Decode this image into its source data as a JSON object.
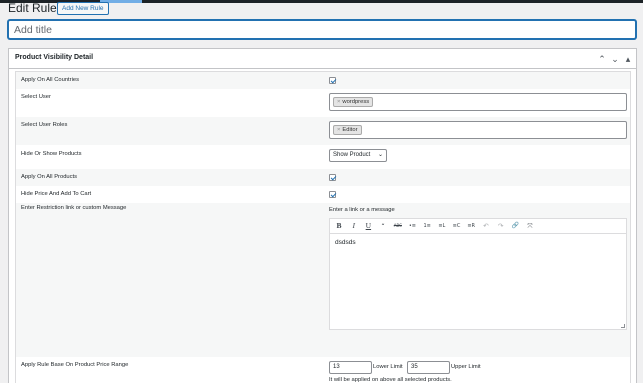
{
  "header": {
    "page_title": "Edit Rule",
    "add_new_label": "Add New Rule"
  },
  "title_input": {
    "placeholder": "Add title",
    "value": ""
  },
  "postbox": {
    "title": "Product Visibility Detail",
    "controls": {
      "move_up": "chevron-up",
      "move_down": "chevron-down",
      "toggle": "triangle-up"
    }
  },
  "fields": {
    "apply_all_countries": {
      "label": "Apply On All Countries",
      "checked": true
    },
    "select_user": {
      "label": "Select User",
      "tags": [
        "wordpress"
      ]
    },
    "select_user_roles": {
      "label": "Select User Roles",
      "tags": [
        "Editor"
      ]
    },
    "hide_show": {
      "label": "Hide Or Show Products",
      "selected": "Show Product"
    },
    "apply_all_products": {
      "label": "Apply On All Products",
      "checked": true
    },
    "hide_price": {
      "label": "Hide Price And Add To Cart",
      "checked": true
    },
    "restriction": {
      "label": "Enter Restriction link or custom Message",
      "sub_label": "Enter a link or a message",
      "content": "dsdsds",
      "toolbar": [
        "B",
        "I",
        "U",
        "“",
        "ABC",
        "•≡",
        "1≡",
        "≡L",
        "≡C",
        "≡R",
        "↶",
        "↷",
        "🔗",
        "⤧"
      ]
    },
    "price_range": {
      "label": "Apply Rule Base On Product Price Range",
      "lower_value": "13",
      "lower_label": "Lower Limit",
      "upper_value": "35",
      "upper_label": "Upper Limit",
      "note": "It will be applied on above all selected products."
    }
  }
}
